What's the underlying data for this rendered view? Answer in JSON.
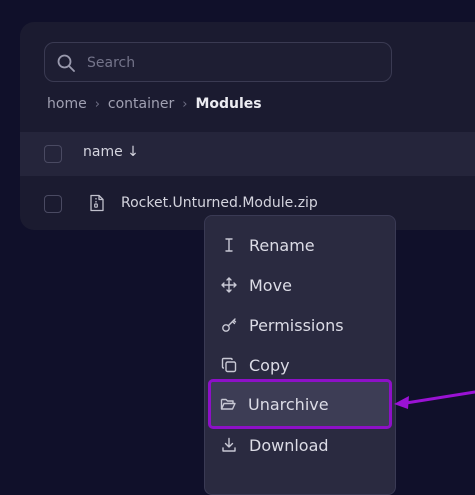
{
  "search": {
    "placeholder": "Search"
  },
  "breadcrumb": {
    "items": [
      "home",
      "container"
    ],
    "current": "Modules"
  },
  "table": {
    "header": {
      "name": "name ↓"
    },
    "rows": [
      {
        "name": "Rocket.Unturned.Module.zip"
      }
    ]
  },
  "context_menu": {
    "items": [
      {
        "label": "Rename",
        "icon": "text-cursor-icon"
      },
      {
        "label": "Move",
        "icon": "move-arrows-icon"
      },
      {
        "label": "Permissions",
        "icon": "key-icon"
      },
      {
        "label": "Copy",
        "icon": "copy-icon"
      },
      {
        "label": "Unarchive",
        "icon": "folder-open-icon",
        "highlighted": true
      },
      {
        "label": "Download",
        "icon": "download-icon"
      }
    ]
  },
  "colors": {
    "background": "#10102a",
    "panel": "#1b1b30",
    "menu": "#2a2a40",
    "highlight": "#8d10c7"
  }
}
